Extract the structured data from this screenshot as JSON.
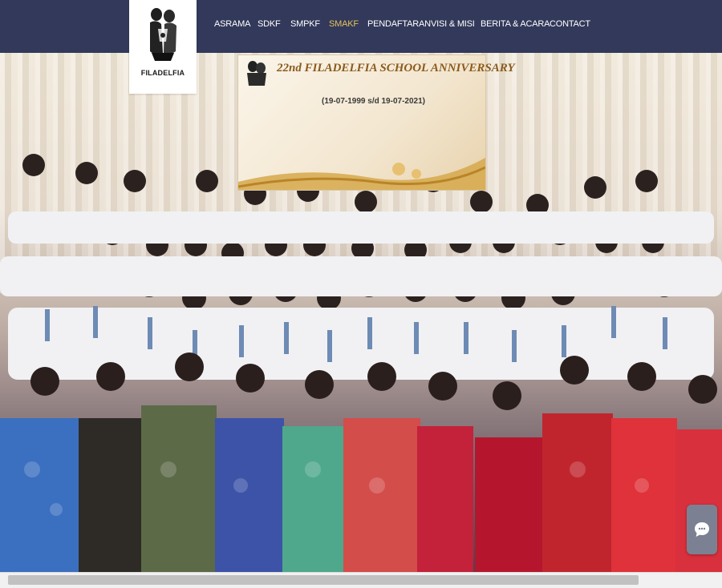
{
  "site": {
    "logo_text": "FILADELFIA"
  },
  "nav": {
    "items": [
      {
        "label": "ASRAMA",
        "active": false
      },
      {
        "label": "SDKF",
        "active": false
      },
      {
        "label": "SMPKF",
        "active": false
      },
      {
        "label": "SMAKF",
        "active": true
      },
      {
        "label": "PENDAFTARAN",
        "active": false
      },
      {
        "label": "VISI & MISI",
        "active": false
      },
      {
        "label": "BERITA & ACARA",
        "active": false
      },
      {
        "label": "CONTACT",
        "active": false
      }
    ],
    "colors": {
      "bar": "#33395a",
      "text": "#ffffff",
      "active": "#e3c25d"
    }
  },
  "hero": {
    "banner": {
      "title": "22nd FILADELFIA SCHOOL ANNIVERSARY",
      "dates": "(19-07-1999 s/d 19-07-2021)"
    }
  },
  "chat": {
    "icon": "chat-bubble-icon"
  }
}
